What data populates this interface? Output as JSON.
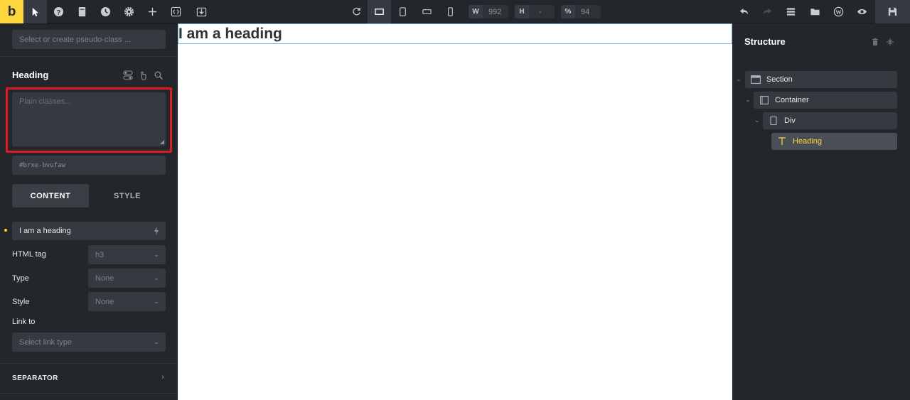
{
  "brand": {
    "logo_letter": "b",
    "accent": "#ffd53e"
  },
  "toolbar": {
    "width_label": "W",
    "width_value": "992",
    "height_label": "H",
    "height_value": "-",
    "zoom_label": "%",
    "zoom_value": "94"
  },
  "left_panel": {
    "pseudo_placeholder": "Select or create pseudo-class ...",
    "element_title": "Heading",
    "classes_placeholder": "Plain classes...",
    "element_id": "#brxe-bvufaw",
    "tabs": [
      {
        "label": "CONTENT"
      },
      {
        "label": "STYLE"
      }
    ],
    "text_value": "I am a heading",
    "fields": {
      "html_tag_label": "HTML tag",
      "html_tag_value": "h3",
      "type_label": "Type",
      "type_value": "None",
      "style_label": "Style",
      "style_value": "None",
      "link_to_label": "Link to",
      "link_type_placeholder": "Select link type"
    },
    "separator_label": "SEPARATOR"
  },
  "canvas": {
    "heading_text": "I am a heading"
  },
  "structure": {
    "title": "Structure",
    "items": [
      {
        "label": "Section"
      },
      {
        "label": "Container"
      },
      {
        "label": "Div"
      },
      {
        "label": "Heading"
      }
    ]
  }
}
